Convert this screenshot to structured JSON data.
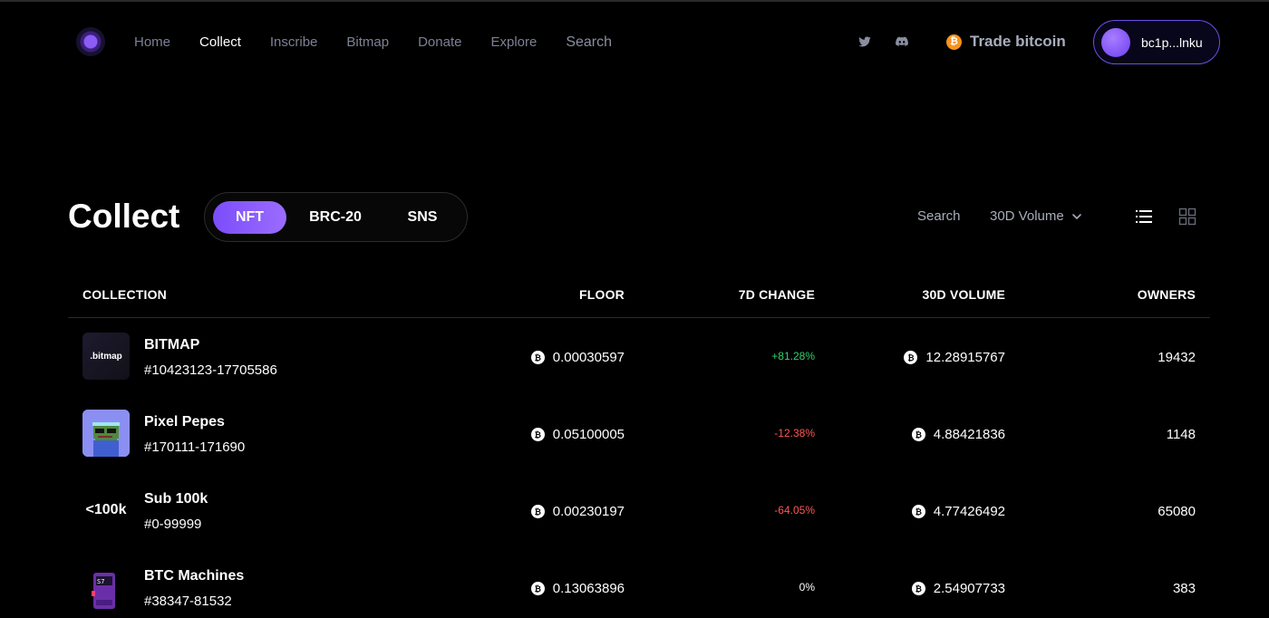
{
  "nav": {
    "links": [
      "Home",
      "Collect",
      "Inscribe",
      "Bitmap",
      "Donate",
      "Explore"
    ],
    "search_label": "Search",
    "active": "Collect",
    "trade_label": "Trade bitcoin",
    "trade_coin_glyph": "₿",
    "wallet_address": "bc1p...lnku",
    "icons": [
      "twitter-icon",
      "discord-icon"
    ]
  },
  "page": {
    "title": "Collect",
    "tabs": [
      "NFT",
      "BRC-20",
      "SNS"
    ],
    "active_tab": "NFT",
    "search_label": "Search",
    "sort_label": "30D Volume"
  },
  "table": {
    "columns": [
      "COLLECTION",
      "FLOOR",
      "7D CHANGE",
      "30D VOLUME",
      "OWNERS"
    ],
    "coin_glyph": "₿",
    "rows": [
      {
        "name": "BITMAP",
        "range": "#10423123-17705586",
        "thumb_text": ".bitmap",
        "floor": "0.00030597",
        "change": "+81.28%",
        "trend": "up",
        "volume": "12.28915767",
        "owners": "19432"
      },
      {
        "name": "Pixel Pepes",
        "range": "#170111-171690",
        "thumb_text": "",
        "floor": "0.05100005",
        "change": "-12.38%",
        "trend": "down",
        "volume": "4.88421836",
        "owners": "1148"
      },
      {
        "name": "Sub 100k",
        "range": "#0-99999",
        "thumb_text": "<100k",
        "floor": "0.00230197",
        "change": "-64.05%",
        "trend": "down",
        "volume": "4.77426492",
        "owners": "65080"
      },
      {
        "name": "BTC Machines",
        "range": "#38347-81532",
        "thumb_text": "",
        "floor": "0.13063896",
        "change": "0%",
        "trend": "flat",
        "volume": "2.54907733",
        "owners": "383"
      }
    ]
  },
  "colors": {
    "accent": "#7b4dfa",
    "positive": "#2fd36b",
    "negative": "#ff5757",
    "muted": "#7c8194"
  }
}
